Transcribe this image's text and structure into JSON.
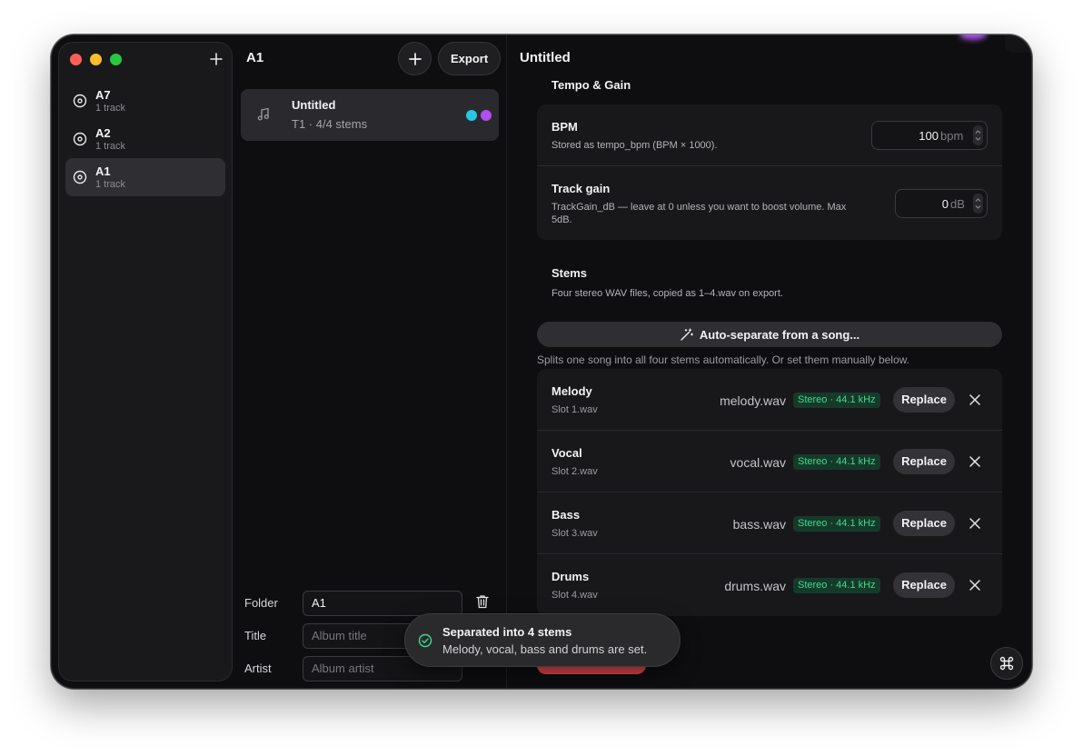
{
  "sidebar": {
    "add_icon": "plus-icon",
    "items": [
      {
        "name": "A7",
        "sub": "1 track",
        "active": false
      },
      {
        "name": "A2",
        "sub": "1 track",
        "active": false
      },
      {
        "name": "A1",
        "sub": "1 track",
        "active": true
      }
    ]
  },
  "middle": {
    "title": "A1",
    "export_label": "Export",
    "track": {
      "name": "Untitled",
      "sub": "T1 · 4/4 stems",
      "colors": [
        "#27c6e6",
        "#b14ef0"
      ]
    },
    "folder": {
      "label": "Folder",
      "value": "A1"
    },
    "title_field": {
      "label": "Title",
      "placeholder": "Album title"
    },
    "artist_field": {
      "label": "Artist",
      "placeholder": "Album artist"
    }
  },
  "detail": {
    "title": "Untitled",
    "tempo_gain": {
      "heading": "Tempo & Gain",
      "bpm": {
        "label": "BPM",
        "desc": "Stored as tempo_bpm (BPM × 1000).",
        "value": "100",
        "unit": "bpm"
      },
      "gain": {
        "label": "Track gain",
        "desc_line1": "TrackGain_dB — leave at 0 unless you want to boost volume. Max",
        "desc_line2": "5dB.",
        "value": "0",
        "unit": "dB"
      }
    },
    "stems": {
      "heading": "Stems",
      "sub": "Four stereo WAV files, copied as 1–4.wav on export.",
      "auto_label": "Auto-separate from a song...",
      "auto_note": "Splits one song into all four stems automatically. Or set them manually below.",
      "replace_label": "Replace",
      "rows": [
        {
          "name": "Melody",
          "slot": "Slot 1.wav",
          "file": "melody.wav",
          "badge": "Stereo · 44.1 kHz"
        },
        {
          "name": "Vocal",
          "slot": "Slot 2.wav",
          "file": "vocal.wav",
          "badge": "Stereo · 44.1 kHz"
        },
        {
          "name": "Bass",
          "slot": "Slot 3.wav",
          "file": "bass.wav",
          "badge": "Stereo · 44.1 kHz"
        },
        {
          "name": "Drums",
          "slot": "Slot 4.wav",
          "file": "drums.wav",
          "badge": "Stereo · 44.1 kHz"
        }
      ]
    }
  },
  "toast": {
    "title": "Separated into 4 stems",
    "message": "Melody, vocal, bass and drums are set."
  },
  "colors": {
    "accent_green": "#3fd98d",
    "danger": "#e5484d",
    "traffic_red": "#ff5f57",
    "traffic_yellow": "#febc2e",
    "traffic_green": "#28c840"
  }
}
